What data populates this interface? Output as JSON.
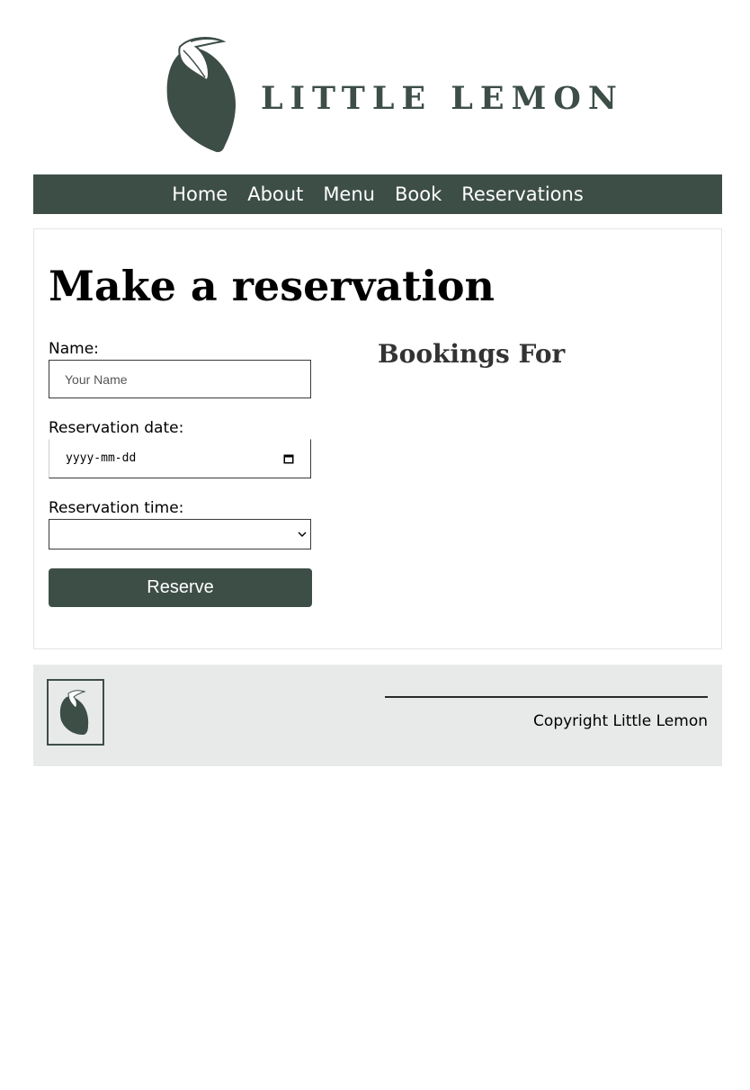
{
  "brand": {
    "name": "LITTLE LEMON",
    "color": "#3d4e47"
  },
  "nav": {
    "items": [
      "Home",
      "About",
      "Menu",
      "Book",
      "Reservations"
    ],
    "background": "#3d4e47"
  },
  "main": {
    "title": "Make a reservation",
    "form": {
      "name_label": "Name:",
      "name_placeholder": "Your Name",
      "name_value": "",
      "date_label": "Reservation date:",
      "date_value": "yyyy-mm-dd",
      "time_label": "Reservation time:",
      "time_value": "",
      "submit_label": "Reserve"
    },
    "bookings_title": "Bookings For"
  },
  "footer": {
    "copyright": "Copyright Little Lemon",
    "background": "#e8eae9"
  },
  "icons": {
    "logo": "lemon-logo-icon",
    "calendar": "calendar-icon",
    "dropdown": "chevron-down-icon",
    "footer_logo": "lemon-logo-icon"
  }
}
